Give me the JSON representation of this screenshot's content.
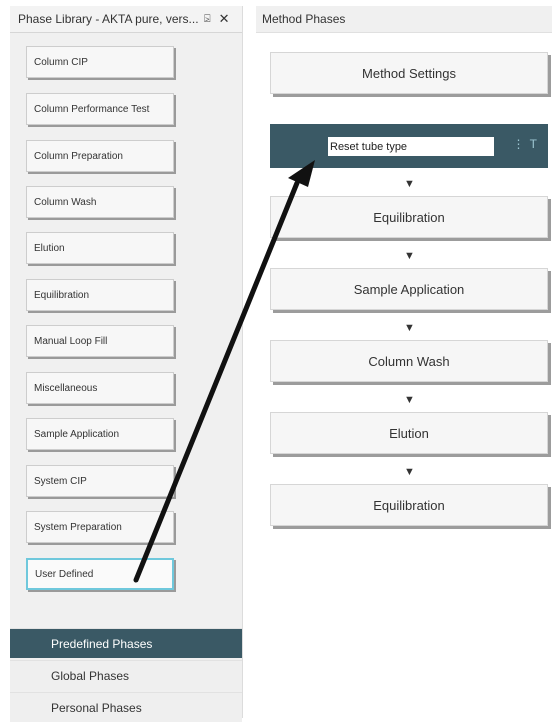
{
  "phase_library": {
    "title": "Phase Library - AKTA pure, vers...",
    "pin_glyph": "⍄",
    "close_glyph": "✕",
    "items": [
      {
        "label": "Column CIP"
      },
      {
        "label": "Column Performance Test"
      },
      {
        "label": "Column Preparation"
      },
      {
        "label": "Column Wash"
      },
      {
        "label": "Elution"
      },
      {
        "label": "Equilibration"
      },
      {
        "label": "Manual Loop Fill"
      },
      {
        "label": "Miscellaneous"
      },
      {
        "label": "Sample Application"
      },
      {
        "label": "System CIP"
      },
      {
        "label": "System Preparation"
      },
      {
        "label": "User Defined",
        "selected": true
      }
    ],
    "tabs": [
      {
        "label": "Predefined Phases",
        "active": true
      },
      {
        "label": "Global Phases"
      },
      {
        "label": "Personal Phases"
      }
    ]
  },
  "method_phases": {
    "title": "Method Phases",
    "settings_label": "Method Settings",
    "new_phase_name": "Reset tube type",
    "menu_glyph": "⋮ T",
    "flow_arrow_glyph": "▼",
    "phases": [
      {
        "label": "Equilibration"
      },
      {
        "label": "Sample Application"
      },
      {
        "label": "Column Wash"
      },
      {
        "label": "Elution"
      },
      {
        "label": "Equilibration"
      }
    ]
  },
  "colors": {
    "accent_dark": "#3a5965",
    "selected_border": "#6fc8dc"
  }
}
